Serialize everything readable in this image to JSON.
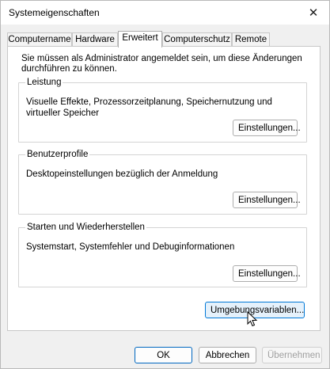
{
  "window": {
    "title": "Systemeigenschaften",
    "close_glyph": "✕"
  },
  "tabs": [
    {
      "label": "Computername",
      "active": false
    },
    {
      "label": "Hardware",
      "active": false
    },
    {
      "label": "Erweitert",
      "active": true
    },
    {
      "label": "Computerschutz",
      "active": false
    },
    {
      "label": "Remote",
      "active": false
    }
  ],
  "panel": {
    "info": "Sie müssen als Administrator angemeldet sein, um diese Änderungen durchführen zu können.",
    "groups": [
      {
        "title": "Leistung",
        "description": "Visuelle Effekte, Prozessorzeitplanung, Speichernutzung und virtueller Speicher",
        "button": "Einstellungen..."
      },
      {
        "title": "Benutzerprofile",
        "description": "Desktopeinstellungen bezüglich der Anmeldung",
        "button": "Einstellungen..."
      },
      {
        "title": "Starten und Wiederherstellen",
        "description": "Systemstart, Systemfehler und Debuginformationen",
        "button": "Einstellungen..."
      }
    ],
    "env_button": "Umgebungsvariablen..."
  },
  "footer": {
    "ok": "OK",
    "cancel": "Abbrechen",
    "apply": "Übernehmen"
  },
  "cursor_icon": "mouse-pointer-icon"
}
